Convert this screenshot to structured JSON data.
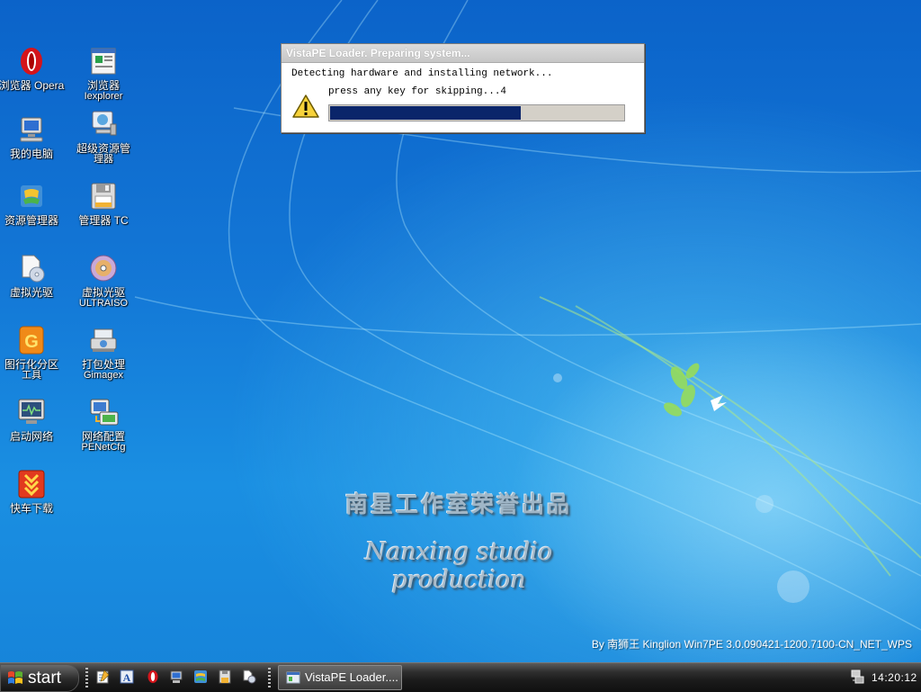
{
  "desktop": {
    "icons": [
      {
        "label": "浏览器 Opera",
        "sub": "",
        "icon": "opera-icon"
      },
      {
        "label": "浏览器",
        "sub": "Iexplorer",
        "icon": "iexplorer-icon"
      },
      {
        "label": "我的电脑",
        "sub": "",
        "icon": "my-computer-icon"
      },
      {
        "label": "超级资源管",
        "sub": "理器",
        "icon": "super-explorer-icon"
      },
      {
        "label": "资源管理器",
        "sub": "",
        "icon": "explorer-icon"
      },
      {
        "label": "管理器 TC",
        "sub": "",
        "icon": "floppy-icon"
      },
      {
        "label": "虚拟光驱",
        "sub": "",
        "icon": "virtual-drive-icon"
      },
      {
        "label": "虚拟光驱",
        "sub": "ULTRAISO",
        "icon": "cd-icon"
      },
      {
        "label": "图行化分区",
        "sub": "工具",
        "icon": "partition-icon"
      },
      {
        "label": "打包处理",
        "sub": "Gimagex",
        "icon": "gimagex-icon"
      },
      {
        "label": "启动网络",
        "sub": "",
        "icon": "network-monitor-icon"
      },
      {
        "label": "网络配置",
        "sub": "PENetCfg",
        "icon": "network-config-icon"
      },
      {
        "label": "快车下载",
        "sub": "",
        "icon": "flashget-icon"
      }
    ],
    "wallpaper": {
      "chinese_text": "南星工作室荣誉出品",
      "english_text": "Nanxing studio production",
      "build_info": "By 南狮王 Kinglion Win7PE 3.0.090421-1200.7100-CN_NET_WPS"
    }
  },
  "loader_dialog": {
    "title": "VistaPE Loader. Preparing system...",
    "line1": "Detecting hardware and installing network...",
    "line2": "press any key for skipping...4",
    "progress": 0.65,
    "icon": "warning-icon"
  },
  "taskbar": {
    "start_label": "start",
    "quick_launch": [
      "notepad-icon",
      "font-icon",
      "opera-icon",
      "computer-icon",
      "explorer-icon",
      "floppy-icon",
      "virtual-drive-icon"
    ],
    "task_button_label": "VistaPE Loader....",
    "clock": "14:20:12",
    "tray_icon": "network-tray-icon"
  },
  "colors": {
    "progress_fill": "#0a256a",
    "desktop_blue": "#1377d6",
    "taskbar": "#1b1b1b"
  }
}
